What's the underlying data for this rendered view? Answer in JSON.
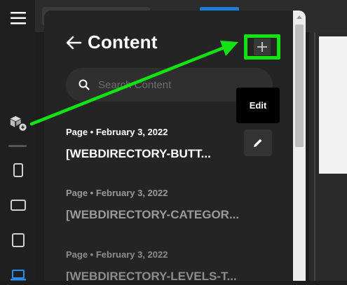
{
  "panel": {
    "title": "Content",
    "search_placeholder": "Search Content",
    "items": [
      {
        "meta": "Page • February 3, 2022",
        "name": "[WEBDIRECTORY-BUTT..."
      },
      {
        "meta": "Page • February 3, 2022",
        "name": "[WEBDIRECTORY-CATEGOR..."
      },
      {
        "meta": "Page • February 3, 2022",
        "name": "[WEBDIRECTORY-LEVELS-T..."
      }
    ]
  },
  "tooltip": {
    "edit_label": "Edit"
  },
  "colors": {
    "accent_green": "#12e312",
    "panel_bg": "#242424",
    "blue_accent": "#1e7ed6"
  },
  "icons": [
    "menu-icon",
    "add-block-icon",
    "mobile-icon",
    "tablet-landscape-icon",
    "tablet-icon",
    "laptop-icon",
    "back-arrow-icon",
    "plus-icon",
    "search-icon",
    "pencil-icon"
  ]
}
